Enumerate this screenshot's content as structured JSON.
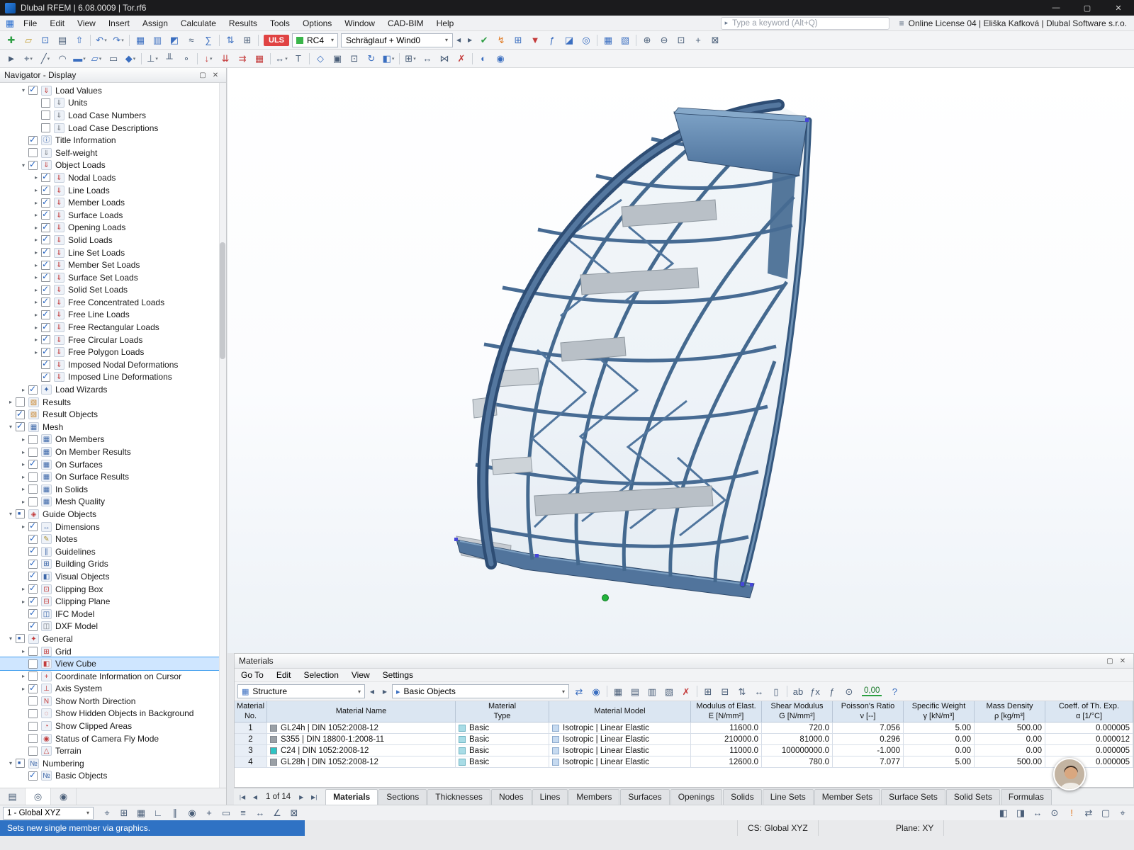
{
  "window": {
    "title": "Dlubal RFEM | 6.08.0009 | Tor.rf6",
    "minimize": "—",
    "maximize": "▢",
    "close": "✕"
  },
  "ui": {
    "float_glyph": "▢",
    "close_glyph": "✕",
    "search_arrow": "▸",
    "menu_logo": "▦",
    "license_icon": "≡",
    "prev": "◀",
    "next": "▶",
    "help": "?",
    "combo1_icon": "▦",
    "combo2_icon": "▸"
  },
  "menubar": {
    "items": [
      "File",
      "Edit",
      "View",
      "Insert",
      "Assign",
      "Calculate",
      "Results",
      "Tools",
      "Options",
      "Window",
      "CAD-BIM",
      "Help"
    ],
    "search_placeholder": "Type a keyword (Alt+Q)",
    "license_text": "Online License 04 | Eliška Kafková | Dlubal Software s.r.o."
  },
  "toolbar_top": {
    "left_icons": [
      {
        "name": "new-model-icon",
        "g": "✚",
        "cls": "grn"
      },
      {
        "name": "open-model-icon",
        "g": "▱",
        "cls": "ylw"
      },
      {
        "name": "save-model-icon",
        "g": "⊡",
        "cls": "blu"
      },
      {
        "name": "print-icon",
        "g": "▤"
      },
      {
        "name": "export-icon",
        "g": "⇧",
        "cls": "blu"
      },
      {
        "name": "separator",
        "g": "",
        "cls": "sep"
      },
      {
        "name": "undo-icon",
        "g": "↶",
        "cls": "blu dd"
      },
      {
        "name": "redo-icon",
        "g": "↷",
        "cls": "blu dd"
      },
      {
        "name": "separator",
        "g": "",
        "cls": "sep"
      },
      {
        "name": "table-view-icon",
        "g": "▦",
        "cls": "blu"
      },
      {
        "name": "table-edit-icon",
        "g": "▥",
        "cls": "blu"
      },
      {
        "name": "diagram-icon",
        "g": "◩",
        "cls": "blu"
      },
      {
        "name": "section-icon",
        "g": "≈"
      },
      {
        "name": "sum-icon",
        "g": "∑",
        "cls": "blu"
      },
      {
        "name": "separator",
        "g": "",
        "cls": "sep"
      },
      {
        "name": "load-direction-icon",
        "g": "⇅",
        "cls": "blu"
      },
      {
        "name": "renumber-icon",
        "g": "⊞"
      },
      {
        "name": "separator",
        "g": "",
        "cls": "sep"
      }
    ],
    "uls_badge": "ULS",
    "design_combo": "RC4",
    "loadcase_combo": "Schräglauf + Wind0",
    "right_icons": [
      {
        "name": "check-calculation-icon",
        "g": "✔",
        "cls": "grn"
      },
      {
        "name": "calculate-all-icon",
        "g": "↯",
        "cls": "org"
      },
      {
        "name": "calculator-icon",
        "g": "⊞",
        "cls": "blu"
      },
      {
        "name": "filter-results-icon",
        "g": "▼",
        "cls": "red"
      },
      {
        "name": "formula-icon",
        "g": "ƒ",
        "cls": "blu"
      },
      {
        "name": "chart-icon",
        "g": "◪",
        "cls": "blu"
      },
      {
        "name": "visibility-icon",
        "g": "◎",
        "cls": "blu"
      },
      {
        "name": "separator",
        "g": "",
        "cls": "sep"
      },
      {
        "name": "grid-tables-icon",
        "g": "▦",
        "cls": "blu"
      },
      {
        "name": "print-report-icon",
        "g": "▧",
        "cls": "blu"
      },
      {
        "name": "separator",
        "g": "",
        "cls": "sep"
      },
      {
        "name": "zoom-in-icon",
        "g": "⊕"
      },
      {
        "name": "zoom-out-icon",
        "g": "⊖"
      },
      {
        "name": "zoom-window-icon",
        "g": "⊡"
      },
      {
        "name": "pan-icon",
        "g": "+"
      },
      {
        "name": "full-view-icon",
        "g": "⊠"
      }
    ]
  },
  "toolbar_insert": {
    "icons": [
      {
        "name": "select-icon",
        "g": "►"
      },
      {
        "name": "insert-node-icon",
        "g": "⌖",
        "cls": "dd"
      },
      {
        "name": "insert-line-icon",
        "g": "╱",
        "cls": "dd"
      },
      {
        "name": "insert-arc-icon",
        "g": "◠"
      },
      {
        "name": "insert-member-icon",
        "g": "▬",
        "cls": "dd blu"
      },
      {
        "name": "insert-surface-icon",
        "g": "▱",
        "cls": "dd blu"
      },
      {
        "name": "insert-opening-icon",
        "g": "▭"
      },
      {
        "name": "insert-solid-icon",
        "g": "◆",
        "cls": "dd blu"
      },
      {
        "name": "separator",
        "g": "",
        "cls": "sep"
      },
      {
        "name": "nodal-support-icon",
        "g": "⊥",
        "cls": "dd"
      },
      {
        "name": "line-support-icon",
        "g": "╨"
      },
      {
        "name": "member-hinge-icon",
        "g": "∘"
      },
      {
        "name": "separator",
        "g": "",
        "cls": "sep"
      },
      {
        "name": "nodal-load-icon",
        "g": "↓",
        "cls": "red dd"
      },
      {
        "name": "line-load-icon",
        "g": "⇊",
        "cls": "red"
      },
      {
        "name": "member-load-icon",
        "g": "⇉",
        "cls": "red"
      },
      {
        "name": "surface-load-icon",
        "g": "▦",
        "cls": "red"
      },
      {
        "name": "separator",
        "g": "",
        "cls": "sep"
      },
      {
        "name": "dimension-icon",
        "g": "↔",
        "cls": "dd"
      },
      {
        "name": "text-annotation-icon",
        "g": "T"
      },
      {
        "name": "separator",
        "g": "",
        "cls": "sep"
      },
      {
        "name": "isometric-view-icon",
        "g": "◇",
        "cls": "blu"
      },
      {
        "name": "view-in-x-icon",
        "g": "▣"
      },
      {
        "name": "zoom-extents-icon",
        "g": "⊡"
      },
      {
        "name": "rotate-view-icon",
        "g": "↻",
        "cls": "blu"
      },
      {
        "name": "render-mode-icon",
        "g": "◧",
        "cls": "dd blu"
      },
      {
        "name": "separator",
        "g": "",
        "cls": "sep"
      },
      {
        "name": "work-plane-icon",
        "g": "⊞",
        "cls": "dd"
      },
      {
        "name": "move-copy-icon",
        "g": "↔"
      },
      {
        "name": "mirror-icon",
        "g": "⋈"
      },
      {
        "name": "delete-icon",
        "g": "✗",
        "cls": "red"
      },
      {
        "name": "separator",
        "g": "",
        "cls": "sep"
      },
      {
        "name": "visibility-by-object-icon",
        "g": "◐",
        "cls": "blu"
      },
      {
        "name": "user-defined-view-icon",
        "g": "◉",
        "cls": "blu"
      }
    ]
  },
  "navigator": {
    "title": "Navigator - Display",
    "items": [
      {
        "label": "Load Values",
        "cls": "l1 on icr",
        "exp": "▾",
        "ig": "⇓"
      },
      {
        "label": "Units",
        "cls": "l2 off icg",
        "exp": "",
        "ig": "⇓"
      },
      {
        "label": "Load Case Numbers",
        "cls": "l2 off icg",
        "exp": "",
        "ig": "⇓"
      },
      {
        "label": "Load Case Descriptions",
        "cls": "l2 off icg",
        "exp": "",
        "ig": "⇓"
      },
      {
        "label": "Title Information",
        "cls": "l1 on icb",
        "exp": "",
        "ig": "ⓘ"
      },
      {
        "label": "Self-weight",
        "cls": "l1 off icg",
        "exp": "",
        "ig": "⇓"
      },
      {
        "label": "Object Loads",
        "cls": "l1 on icr",
        "exp": "▾",
        "ig": "⇓"
      },
      {
        "label": "Nodal Loads",
        "cls": "l2 on icr",
        "exp": "▸",
        "ig": "⇓"
      },
      {
        "label": "Line Loads",
        "cls": "l2 on icr",
        "exp": "▸",
        "ig": "⇓"
      },
      {
        "label": "Member Loads",
        "cls": "l2 on icr",
        "exp": "▸",
        "ig": "⇓"
      },
      {
        "label": "Surface Loads",
        "cls": "l2 on icr",
        "exp": "▸",
        "ig": "⇓"
      },
      {
        "label": "Opening Loads",
        "cls": "l2 on icr",
        "exp": "▸",
        "ig": "⇓"
      },
      {
        "label": "Solid Loads",
        "cls": "l2 on icr",
        "exp": "▸",
        "ig": "⇓"
      },
      {
        "label": "Line Set Loads",
        "cls": "l2 on icr",
        "exp": "▸",
        "ig": "⇓"
      },
      {
        "label": "Member Set Loads",
        "cls": "l2 on icr",
        "exp": "▸",
        "ig": "⇓"
      },
      {
        "label": "Surface Set Loads",
        "cls": "l2 on icr",
        "exp": "▸",
        "ig": "⇓"
      },
      {
        "label": "Solid Set Loads",
        "cls": "l2 on icr",
        "exp": "▸",
        "ig": "⇓"
      },
      {
        "label": "Free Concentrated Loads",
        "cls": "l2 on icr",
        "exp": "▸",
        "ig": "⇓"
      },
      {
        "label": "Free Line Loads",
        "cls": "l2 on icr",
        "exp": "▸",
        "ig": "⇓"
      },
      {
        "label": "Free Rectangular Loads",
        "cls": "l2 on icr",
        "exp": "▸",
        "ig": "⇓"
      },
      {
        "label": "Free Circular Loads",
        "cls": "l2 on icr",
        "exp": "▸",
        "ig": "⇓"
      },
      {
        "label": "Free Polygon Loads",
        "cls": "l2 on icr",
        "exp": "▸",
        "ig": "⇓"
      },
      {
        "label": "Imposed Nodal Deformations",
        "cls": "l2 on icr",
        "exp": "",
        "ig": "⇓"
      },
      {
        "label": "Imposed Line Deformations",
        "cls": "l2 on icr",
        "exp": "",
        "ig": "⇓"
      },
      {
        "label": "Load Wizards",
        "cls": "l1 on icb",
        "exp": "▸",
        "ig": "✦"
      },
      {
        "label": "Results",
        "cls": "l0 off ico",
        "exp": "▸",
        "ig": "▧"
      },
      {
        "label": "Result Objects",
        "cls": "l0 on ico",
        "exp": "",
        "ig": "▧"
      },
      {
        "label": "Mesh",
        "cls": "l0 on icb",
        "exp": "▾",
        "ig": "▦"
      },
      {
        "label": "On Members",
        "cls": "l1 off icb",
        "exp": "▸",
        "ig": "▦"
      },
      {
        "label": "On Member Results",
        "cls": "l1 off icb",
        "exp": "▸",
        "ig": "▦"
      },
      {
        "label": "On Surfaces",
        "cls": "l1 on icb",
        "exp": "▸",
        "ig": "▦"
      },
      {
        "label": "On Surface Results",
        "cls": "l1 off icb",
        "exp": "▸",
        "ig": "▦"
      },
      {
        "label": "In Solids",
        "cls": "l1 off icb",
        "exp": "▸",
        "ig": "▦"
      },
      {
        "label": "Mesh Quality",
        "cls": "l1 off icb",
        "exp": "▸",
        "ig": "▦"
      },
      {
        "label": "Guide Objects",
        "cls": "l0 mix icr",
        "exp": "▾",
        "ig": "◈"
      },
      {
        "label": "Dimensions",
        "cls": "l1 on icb",
        "exp": "▸",
        "ig": "↔"
      },
      {
        "label": "Notes",
        "cls": "l1 on icy",
        "exp": "",
        "ig": "✎"
      },
      {
        "label": "Guidelines",
        "cls": "l1 on icb",
        "exp": "",
        "ig": "∥"
      },
      {
        "label": "Building Grids",
        "cls": "l1 on icb",
        "exp": "",
        "ig": "⊞"
      },
      {
        "label": "Visual Objects",
        "cls": "l1 on icb",
        "exp": "",
        "ig": "◧"
      },
      {
        "label": "Clipping Box",
        "cls": "l1 on icr",
        "exp": "▸",
        "ig": "⊡"
      },
      {
        "label": "Clipping Plane",
        "cls": "l1 on icr",
        "exp": "▸",
        "ig": "⊟"
      },
      {
        "label": "IFC Model",
        "cls": "l1 on icb",
        "exp": "",
        "ig": "◫"
      },
      {
        "label": "DXF Model",
        "cls": "l1 on icg",
        "exp": "",
        "ig": "◫"
      },
      {
        "label": "General",
        "cls": "l0 mix icr",
        "exp": "▾",
        "ig": "✦"
      },
      {
        "label": "Grid",
        "cls": "l1 off icr",
        "exp": "▸",
        "ig": "⊞"
      },
      {
        "label": "View Cube",
        "cls": "l1 off sel icr",
        "exp": "",
        "ig": "◧"
      },
      {
        "label": "Coordinate Information on Cursor",
        "cls": "l1 off icr",
        "exp": "▸",
        "ig": "+"
      },
      {
        "label": "Axis System",
        "cls": "l1 on icr",
        "exp": "▸",
        "ig": "⊥"
      },
      {
        "label": "Show North Direction",
        "cls": "l1 off icr",
        "exp": "",
        "ig": "N"
      },
      {
        "label": "Show Hidden Objects in Background",
        "cls": "l1 off icr",
        "exp": "",
        "ig": "◌"
      },
      {
        "label": "Show Clipped Areas",
        "cls": "l1 off icr",
        "exp": "",
        "ig": "◔"
      },
      {
        "label": "Status of Camera Fly Mode",
        "cls": "l1 off icr",
        "exp": "",
        "ig": "◉"
      },
      {
        "label": "Terrain",
        "cls": "l1 off icr",
        "exp": "",
        "ig": "△"
      },
      {
        "label": "Numbering",
        "cls": "l0 mix icb",
        "exp": "▾",
        "ig": "№"
      },
      {
        "label": "Basic Objects",
        "cls": "l1 on icb",
        "exp": "",
        "ig": "№"
      }
    ],
    "tabs": [
      {
        "name": "navigator-tab-data",
        "g": "▤",
        "cls": ""
      },
      {
        "name": "navigator-tab-display",
        "g": "◎",
        "cls": "active"
      },
      {
        "name": "navigator-tab-views",
        "g": "◉",
        "cls": ""
      }
    ]
  },
  "materials": {
    "title": "Materials",
    "menu": [
      "Go To",
      "Edit",
      "Selection",
      "View",
      "Settings"
    ],
    "nav_combo": "Structure",
    "objects_combo": "Basic Objects",
    "toolbar_icons": [
      {
        "name": "sync-selection-icon",
        "g": "⇄",
        "cls": "blu"
      },
      {
        "name": "highlight-in-graphic-icon",
        "g": "◉",
        "cls": "blu"
      },
      {
        "name": "separator",
        "g": "",
        "cls": "sep"
      },
      {
        "name": "table-settings-icon",
        "g": "▦"
      },
      {
        "name": "export-table-icon",
        "g": "▤"
      },
      {
        "name": "import-table-icon",
        "g": "▥"
      },
      {
        "name": "print-table-icon",
        "g": "▧"
      },
      {
        "name": "delete-row-icon",
        "g": "✗",
        "cls": "red"
      },
      {
        "name": "separator",
        "g": "",
        "cls": "sep"
      },
      {
        "name": "insert-row-icon",
        "g": "⊞"
      },
      {
        "name": "copy-row-icon",
        "g": "⊟"
      },
      {
        "name": "move-row-icon",
        "g": "⇅"
      },
      {
        "name": "fit-columns-icon",
        "g": "↔"
      },
      {
        "name": "column-filter-icon",
        "g": "▯"
      },
      {
        "name": "separator",
        "g": "",
        "cls": "sep"
      },
      {
        "name": "font-icon",
        "g": "ab"
      },
      {
        "name": "formula-bar-icon",
        "g": "ƒx"
      },
      {
        "name": "formula-icon",
        "g": "ƒ"
      },
      {
        "name": "units-icon",
        "g": "⊙"
      }
    ],
    "value_display": "0,00",
    "table": {
      "headers": [
        "Material\nNo.",
        "Material Name",
        "Material\nType",
        "Material Model",
        "Modulus of Elast.\nE [N/mm²]",
        "Shear Modulus\nG [N/mm²]",
        "Poisson's Ratio\nν [--]",
        "Specific Weight\nγ [kN/m³]",
        "Mass Density\nρ [kg/m³]",
        "Coeff. of Th. Exp.\nα [1/°C]"
      ],
      "rows": [
        {
          "no": "1",
          "sw_style": "background:#9aa0a6",
          "name": "GL24h | DIN 1052:2008-12",
          "type": "Basic",
          "model": "Isotropic | Linear Elastic",
          "e": "11600.0",
          "g": "720.0",
          "nu": "7.056",
          "gamma": "5.00",
          "rho": "500.00",
          "alpha": "0.000005"
        },
        {
          "no": "2",
          "sw_style": "background:#9aa0a6",
          "name": "S355 | DIN 18800-1:2008-11",
          "type": "Basic",
          "model": "Isotropic | Linear Elastic",
          "e": "210000.0",
          "g": "81000.0",
          "nu": "0.296",
          "gamma": "0.00",
          "rho": "0.00",
          "alpha": "0.000012"
        },
        {
          "no": "3",
          "sw_style": "background:#2ec4c4",
          "name": "C24 | DIN 1052:2008-12",
          "type": "Basic",
          "model": "Isotropic | Linear Elastic",
          "e": "11000.0",
          "g": "100000000.0",
          "nu": "-1.000",
          "gamma": "0.00",
          "rho": "0.00",
          "alpha": "0.000005"
        },
        {
          "no": "4",
          "sw_style": "background:#9aa0a6",
          "name": "GL28h | DIN 1052:2008-12",
          "type": "Basic",
          "model": "Isotropic | Linear Elastic",
          "e": "12600.0",
          "g": "780.0",
          "nu": "7.077",
          "gamma": "5.00",
          "rho": "500.00",
          "alpha": "0.000005"
        }
      ]
    }
  },
  "bottom_tabs": {
    "pager": {
      "first": "|◀",
      "prev": "◀",
      "label": "1 of 14",
      "next": "▶",
      "last": "▶|"
    },
    "tabs": [
      {
        "label": "Materials",
        "cls": "active"
      },
      {
        "label": "Sections",
        "cls": ""
      },
      {
        "label": "Thicknesses",
        "cls": ""
      },
      {
        "label": "Nodes",
        "cls": ""
      },
      {
        "label": "Lines",
        "cls": ""
      },
      {
        "label": "Members",
        "cls": ""
      },
      {
        "label": "Surfaces",
        "cls": ""
      },
      {
        "label": "Openings",
        "cls": ""
      },
      {
        "label": "Solids",
        "cls": ""
      },
      {
        "label": "Line Sets",
        "cls": ""
      },
      {
        "label": "Member Sets",
        "cls": ""
      },
      {
        "label": "Surface Sets",
        "cls": ""
      },
      {
        "label": "Solid Sets",
        "cls": ""
      },
      {
        "label": "Formulas",
        "cls": ""
      }
    ]
  },
  "statusbar": {
    "combo": "1 - Global XYZ",
    "icons": [
      {
        "name": "snap-icon",
        "g": "⌖"
      },
      {
        "name": "grid-snap-icon",
        "g": "⊞"
      },
      {
        "name": "grid-toggle-icon",
        "g": "▦"
      },
      {
        "name": "ortho-icon",
        "g": "∟"
      },
      {
        "name": "guidelines-snap-icon",
        "g": "∥"
      },
      {
        "name": "object-snap-icon",
        "g": "◉"
      },
      {
        "name": "crosshair-icon",
        "g": "+"
      },
      {
        "name": "selection-window-icon",
        "g": "▭"
      },
      {
        "name": "layers-icon",
        "g": "≡"
      },
      {
        "name": "measure-icon",
        "g": "↔"
      },
      {
        "name": "angle-snap-icon",
        "g": "∠"
      },
      {
        "name": "clipping-icon",
        "g": "⊠"
      }
    ],
    "right_icons": [
      {
        "name": "render-toggle-icon",
        "g": "◧"
      },
      {
        "name": "shadow-toggle-icon",
        "g": "◨"
      },
      {
        "name": "ruler-icon",
        "g": "↔"
      },
      {
        "name": "units-settings-icon",
        "g": "⊙"
      },
      {
        "name": "messages-icon",
        "g": "!",
        "cls": "org"
      },
      {
        "name": "sync-view-icon",
        "g": "⇄"
      },
      {
        "name": "fullscreen-icon",
        "g": "▢"
      },
      {
        "name": "target-icon",
        "g": "⌖"
      }
    ],
    "cs_label": "CS: Global XYZ",
    "plane_label": "Plane: XY",
    "message": "Sets new single member via graphics."
  }
}
